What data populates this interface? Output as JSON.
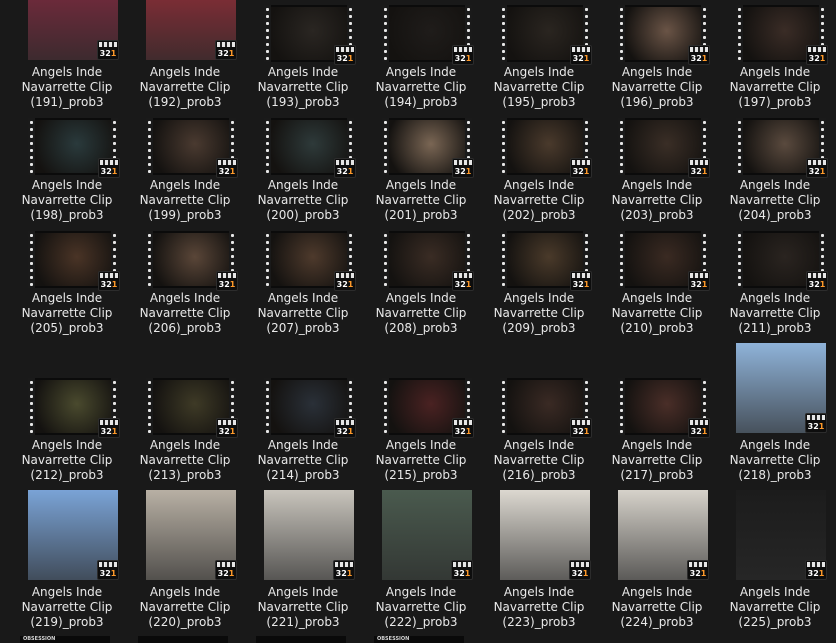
{
  "window": {
    "title": "Angels Inde Navarrette Clip"
  },
  "colors": {
    "background": "#191919",
    "caption_text": "#e9e9e9",
    "badge_orange": "#ff9a2a"
  },
  "badge_icon": {
    "name": "media-player-classic-icon",
    "text": "321"
  },
  "bottom_partial_row": [
    {
      "label": "OBSESSION"
    },
    {
      "label": ""
    },
    {
      "label": ""
    },
    {
      "label": "OBSESSION"
    }
  ],
  "files": [
    {
      "line1": "Angels Inde",
      "line2": "Navarrette Clip",
      "line3": "(191)_prob3",
      "thumb": "photo",
      "tone": "#6b2a3a"
    },
    {
      "line1": "Angels Inde",
      "line2": "Navarrette Clip",
      "line3": "(192)_prob3",
      "thumb": "photo",
      "tone": "#7a2d35"
    },
    {
      "line1": "Angels Inde",
      "line2": "Navarrette Clip",
      "line3": "(193)_prob3",
      "thumb": "film",
      "tone": "#2a2622"
    },
    {
      "line1": "Angels Inde",
      "line2": "Navarrette Clip",
      "line3": "(194)_prob3",
      "thumb": "film",
      "tone": "#1f1c1a"
    },
    {
      "line1": "Angels Inde",
      "line2": "Navarrette Clip",
      "line3": "(195)_prob3",
      "thumb": "film",
      "tone": "#2a2520"
    },
    {
      "line1": "Angels Inde",
      "line2": "Navarrette Clip",
      "line3": "(196)_prob3",
      "thumb": "film",
      "tone": "#6a5446"
    },
    {
      "line1": "Angels Inde",
      "line2": "Navarrette Clip",
      "line3": "(197)_prob3",
      "thumb": "film",
      "tone": "#3a2c26"
    },
    {
      "line1": "Angels Inde",
      "line2": "Navarrette Clip",
      "line3": "(198)_prob3",
      "thumb": "film",
      "tone": "#2a3a3c"
    },
    {
      "line1": "Angels Inde",
      "line2": "Navarrette Clip",
      "line3": "(199)_prob3",
      "thumb": "film",
      "tone": "#4a3a30"
    },
    {
      "line1": "Angels Inde",
      "line2": "Navarrette Clip",
      "line3": "(200)_prob3",
      "thumb": "film",
      "tone": "#2e3a3a"
    },
    {
      "line1": "Angels Inde",
      "line2": "Navarrette Clip",
      "line3": "(201)_prob3",
      "thumb": "film",
      "tone": "#7a6654"
    },
    {
      "line1": "Angels Inde",
      "line2": "Navarrette Clip",
      "line3": "(202)_prob3",
      "thumb": "film",
      "tone": "#4a3a2c"
    },
    {
      "line1": "Angels Inde",
      "line2": "Navarrette Clip",
      "line3": "(203)_prob3",
      "thumb": "film",
      "tone": "#3a2e26"
    },
    {
      "line1": "Angels Inde",
      "line2": "Navarrette Clip",
      "line3": "(204)_prob3",
      "thumb": "film",
      "tone": "#5a4a3e"
    },
    {
      "line1": "Angels Inde",
      "line2": "Navarrette Clip",
      "line3": "(205)_prob3",
      "thumb": "film",
      "tone": "#4a3426"
    },
    {
      "line1": "Angels Inde",
      "line2": "Navarrette Clip",
      "line3": "(206)_prob3",
      "thumb": "film",
      "tone": "#5a4638"
    },
    {
      "line1": "Angels Inde",
      "line2": "Navarrette Clip",
      "line3": "(207)_prob3",
      "thumb": "film",
      "tone": "#4e3a2c"
    },
    {
      "line1": "Angels Inde",
      "line2": "Navarrette Clip",
      "line3": "(208)_prob3",
      "thumb": "film",
      "tone": "#3a2c24"
    },
    {
      "line1": "Angels Inde",
      "line2": "Navarrette Clip",
      "line3": "(209)_prob3",
      "thumb": "film",
      "tone": "#4a3a2a"
    },
    {
      "line1": "Angels Inde",
      "line2": "Navarrette Clip",
      "line3": "(210)_prob3",
      "thumb": "film",
      "tone": "#3a2a22"
    },
    {
      "line1": "Angels Inde",
      "line2": "Navarrette Clip",
      "line3": "(211)_prob3",
      "thumb": "film",
      "tone": "#2a2420"
    },
    {
      "line1": "Angels Inde",
      "line2": "Navarrette Clip",
      "line3": "(212)_prob3",
      "thumb": "film",
      "tone": "#4a4a2e"
    },
    {
      "line1": "Angels Inde",
      "line2": "Navarrette Clip",
      "line3": "(213)_prob3",
      "thumb": "film",
      "tone": "#3e3a26"
    },
    {
      "line1": "Angels Inde",
      "line2": "Navarrette Clip",
      "line3": "(214)_prob3",
      "thumb": "film",
      "tone": "#2a3038"
    },
    {
      "line1": "Angels Inde",
      "line2": "Navarrette Clip",
      "line3": "(215)_prob3",
      "thumb": "film",
      "tone": "#4a2222"
    },
    {
      "line1": "Angels Inde",
      "line2": "Navarrette Clip",
      "line3": "(216)_prob3",
      "thumb": "film",
      "tone": "#3a2a24"
    },
    {
      "line1": "Angels Inde",
      "line2": "Navarrette Clip",
      "line3": "(217)_prob3",
      "thumb": "film",
      "tone": "#4a2e28"
    },
    {
      "line1": "Angels Inde",
      "line2": "Navarrette Clip",
      "line3": "(218)_prob3",
      "thumb": "photo",
      "tone": "#8fb3d9"
    },
    {
      "line1": "Angels Inde",
      "line2": "Navarrette Clip",
      "line3": "(219)_prob3",
      "thumb": "photo",
      "tone": "#7aa3d6"
    },
    {
      "line1": "Angels Inde",
      "line2": "Navarrette Clip",
      "line3": "(220)_prob3",
      "thumb": "photo",
      "tone": "#b8b0a4"
    },
    {
      "line1": "Angels Inde",
      "line2": "Navarrette Clip",
      "line3": "(221)_prob3",
      "thumb": "photo",
      "tone": "#c8c4bc"
    },
    {
      "line1": "Angels Inde",
      "line2": "Navarrette Clip",
      "line3": "(222)_prob3",
      "thumb": "photo",
      "tone": "#4a5a4e"
    },
    {
      "line1": "Angels Inde",
      "line2": "Navarrette Clip",
      "line3": "(223)_prob3",
      "thumb": "photo",
      "tone": "#dcd8d0"
    },
    {
      "line1": "Angels Inde",
      "line2": "Navarrette Clip",
      "line3": "(224)_prob3",
      "thumb": "photo",
      "tone": "#d6d2ca"
    },
    {
      "line1": "Angels Inde",
      "line2": "Navarrette Clip",
      "line3": "(225)_prob3",
      "thumb": "photo",
      "tone": "#1c1c1c"
    }
  ]
}
